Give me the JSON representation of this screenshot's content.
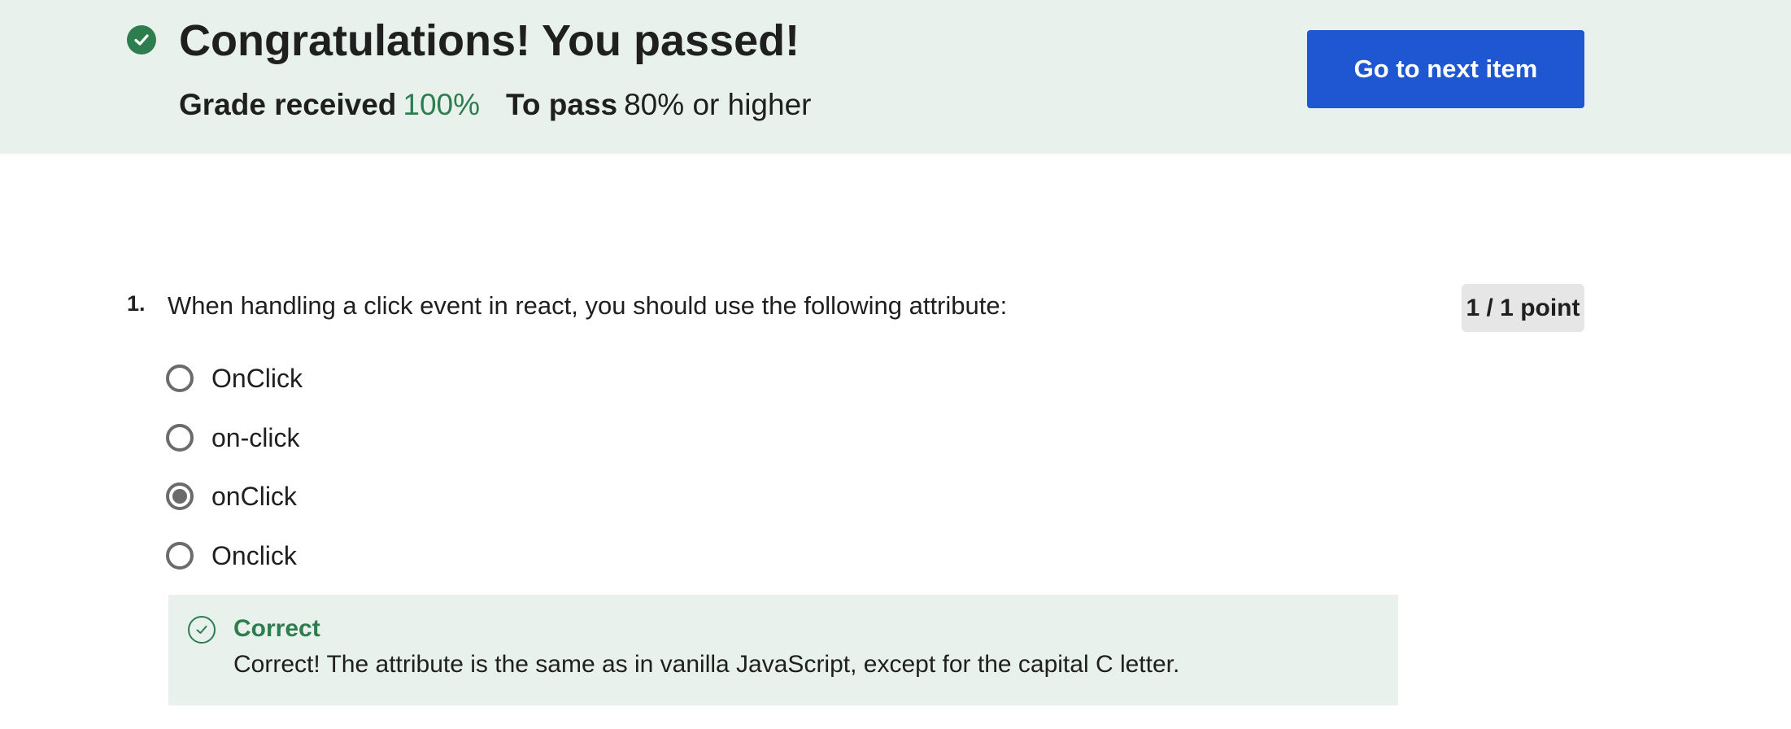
{
  "banner": {
    "title": "Congratulations! You passed!",
    "grade_label": "Grade received",
    "grade_value": "100%",
    "pass_label": "To pass",
    "pass_value": "80% or higher",
    "next_button": "Go to next item",
    "icon": "check-circle-icon",
    "accent_color": "#2e7d4f",
    "button_color": "#1f56d1"
  },
  "question": {
    "number": "1.",
    "text": "When handling a click event in react, you should use the following attribute:",
    "points": "1 / 1 point",
    "options": [
      {
        "label": "OnClick",
        "selected": false
      },
      {
        "label": "on-click",
        "selected": false
      },
      {
        "label": "onClick",
        "selected": true
      },
      {
        "label": "Onclick",
        "selected": false
      }
    ],
    "feedback": {
      "title": "Correct",
      "text": "Correct! The attribute is the same as in vanilla JavaScript, except for the capital C letter.",
      "icon": "check-outline-icon"
    }
  }
}
